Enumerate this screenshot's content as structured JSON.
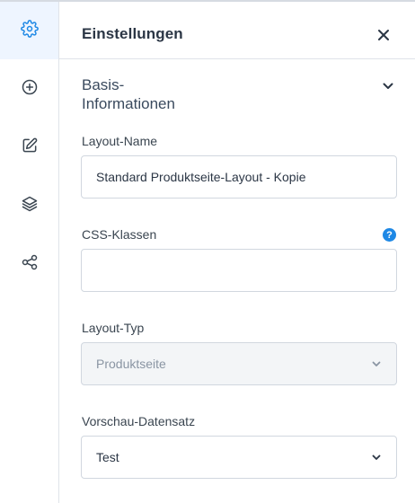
{
  "sidebar": {
    "items": [
      {
        "icon": "gear-icon",
        "active": true
      },
      {
        "icon": "plus-circle-icon",
        "active": false
      },
      {
        "icon": "edit-icon",
        "active": false
      },
      {
        "icon": "layers-icon",
        "active": false
      },
      {
        "icon": "share-icon",
        "active": false
      }
    ]
  },
  "panel": {
    "title": "Einstellungen",
    "section": {
      "title_line1": "Basis-",
      "title_line2": "Informationen"
    },
    "fields": {
      "layout_name": {
        "label": "Layout-Name",
        "value": "Standard Produktseite-Layout - Kopie"
      },
      "css_classes": {
        "label": "CSS-Klassen",
        "value": "",
        "help": "?"
      },
      "layout_type": {
        "label": "Layout-Typ",
        "value": "Produktseite"
      },
      "preview_record": {
        "label": "Vorschau-Datensatz",
        "value": "Test"
      }
    }
  },
  "colors": {
    "accent": "#1e88e5",
    "active_bg": "#eef5ff",
    "border": "#d1d7df",
    "text": "#2b3645"
  }
}
